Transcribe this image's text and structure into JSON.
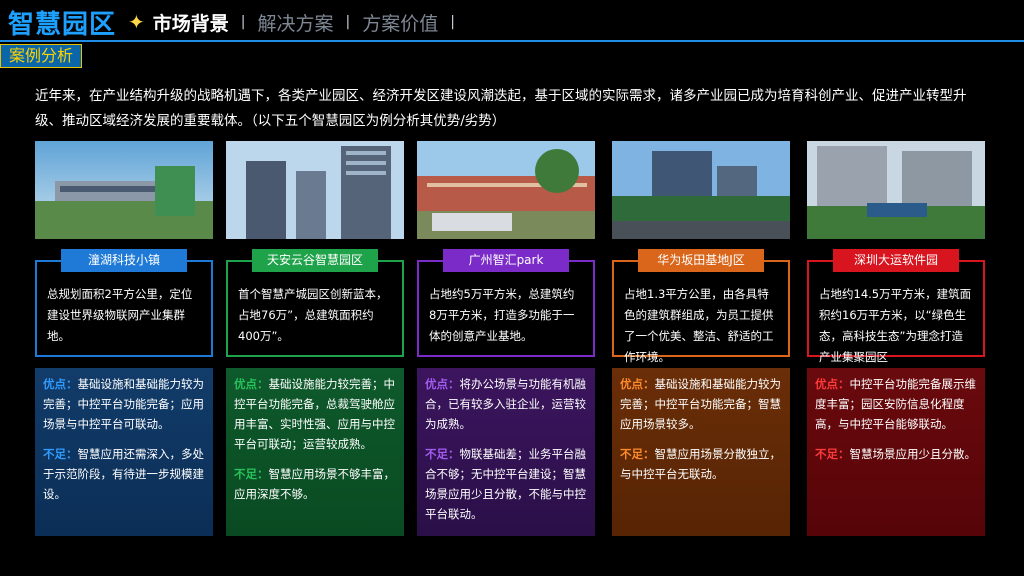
{
  "header": {
    "brand": "智慧园区",
    "nav": [
      "市场背景",
      "解决方案",
      "方案价值"
    ]
  },
  "section_title": "案例分析",
  "intro": "近年来，在产业结构升级的战略机遇下，各类产业园区、经济开发区建设风潮迭起，基于区域的实际需求，诸多产业园已成为培育科创产业、促进产业转型升级、推动区域经济发展的重要载体。（以下五个智慧园区为例分析其优势/劣势）",
  "cases": [
    {
      "name": "潼湖科技小镇",
      "color": "#1e7ad6",
      "desc": "总规划面积2平方公里，定位建设世界级物联网产业集群地。",
      "pros_label": "优点：",
      "pros": "基础设施和基础能力较为完善；中控平台功能完备；应用场景与中控平台可联动。",
      "cons_label": "不足：",
      "cons": "智慧应用还需深入，多处于示范阶段，有待进一步规模建设。"
    },
    {
      "name": "天安云谷智慧园区",
      "color": "#1fa34a",
      "desc": "首个智慧产城园区创新蓝本，占地76万”，总建筑面积约 400万”。",
      "pros_label": "优点：",
      "pros": "基础设施能力较完善；中控平台功能完备，总裁驾驶舱应用丰富、实时性强、应用与中控平台可联动；运营较成熟。",
      "cons_label": "不足：",
      "cons": "智慧应用场景不够丰富，应用深度不够。"
    },
    {
      "name": "广州智汇park",
      "color": "#7a2bc8",
      "desc": "占地约5万平方米，总建筑约 8万平方米，打造多功能于一体的创意产业基地。",
      "pros_label": "优点：",
      "pros": "将办公场景与功能有机融合，已有较多入驻企业，运营较为成熟。",
      "cons_label": "不足：",
      "cons": "物联基础差；业务平台融合不够；无中控平台建设；智慧场景应用少且分散，不能与中控平台联动。"
    },
    {
      "name": "华为坂田基地J区",
      "color": "#d9661a",
      "desc": "占地1.3平方公里，由各具特色的建筑群组成，为员工提供了一个优美、整洁、舒适的工作环境。",
      "pros_label": "优点：",
      "pros": "基础设施和基础能力较为完善；中控平台功能完备；智慧应用场景较多。",
      "cons_label": "不足：",
      "cons": "智慧应用场景分散独立，与中控平台无联动。"
    },
    {
      "name": "深圳大运软件园",
      "color": "#d8141f",
      "desc": "占地约14.5万平方米，建筑面积约16万平方米，以“绿色生态，高科技生态”为理念打造产业集聚园区",
      "pros_label": "优点：",
      "pros": "中控平台功能完备展示维度丰富；园区安防信息化程度高，与中控平台能够联动。",
      "cons_label": "不足：",
      "cons": "智慧场景应用少且分散。"
    }
  ]
}
